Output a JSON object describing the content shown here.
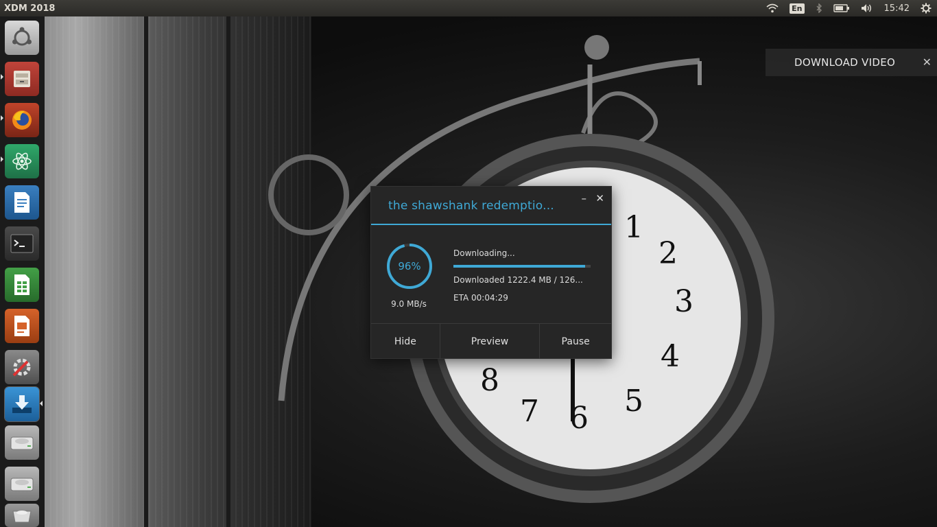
{
  "topbar": {
    "app_title": "XDM 2018",
    "language": "En",
    "clock": "15:42"
  },
  "launcher": {
    "items": [
      {
        "name": "ubuntu-dash"
      },
      {
        "name": "files"
      },
      {
        "name": "firefox"
      },
      {
        "name": "atom"
      },
      {
        "name": "libreoffice-writer"
      },
      {
        "name": "terminal"
      },
      {
        "name": "libreoffice-calc"
      },
      {
        "name": "libreoffice-impress"
      },
      {
        "name": "system-settings"
      },
      {
        "name": "xdm"
      },
      {
        "name": "drive-1"
      },
      {
        "name": "drive-2"
      },
      {
        "name": "trash"
      }
    ]
  },
  "video_popup": {
    "label": "DOWNLOAD VIDEO",
    "close": "✕"
  },
  "dialog": {
    "title": "the shawshank redemptio...",
    "minimize": "–",
    "close": "✕",
    "percent": "96%",
    "progress": 0.96,
    "speed": "9.0 MB/s",
    "status": "Downloading...",
    "downloaded": "Downloaded 1222.4 MB / 126...",
    "eta": "ETA 00:04:29",
    "buttons": {
      "hide": "Hide",
      "preview": "Preview",
      "pause": "Pause"
    }
  },
  "colors": {
    "accent": "#3fa9d6",
    "dialog_bg": "#262626",
    "topbar_bg": "#2b2a27"
  }
}
